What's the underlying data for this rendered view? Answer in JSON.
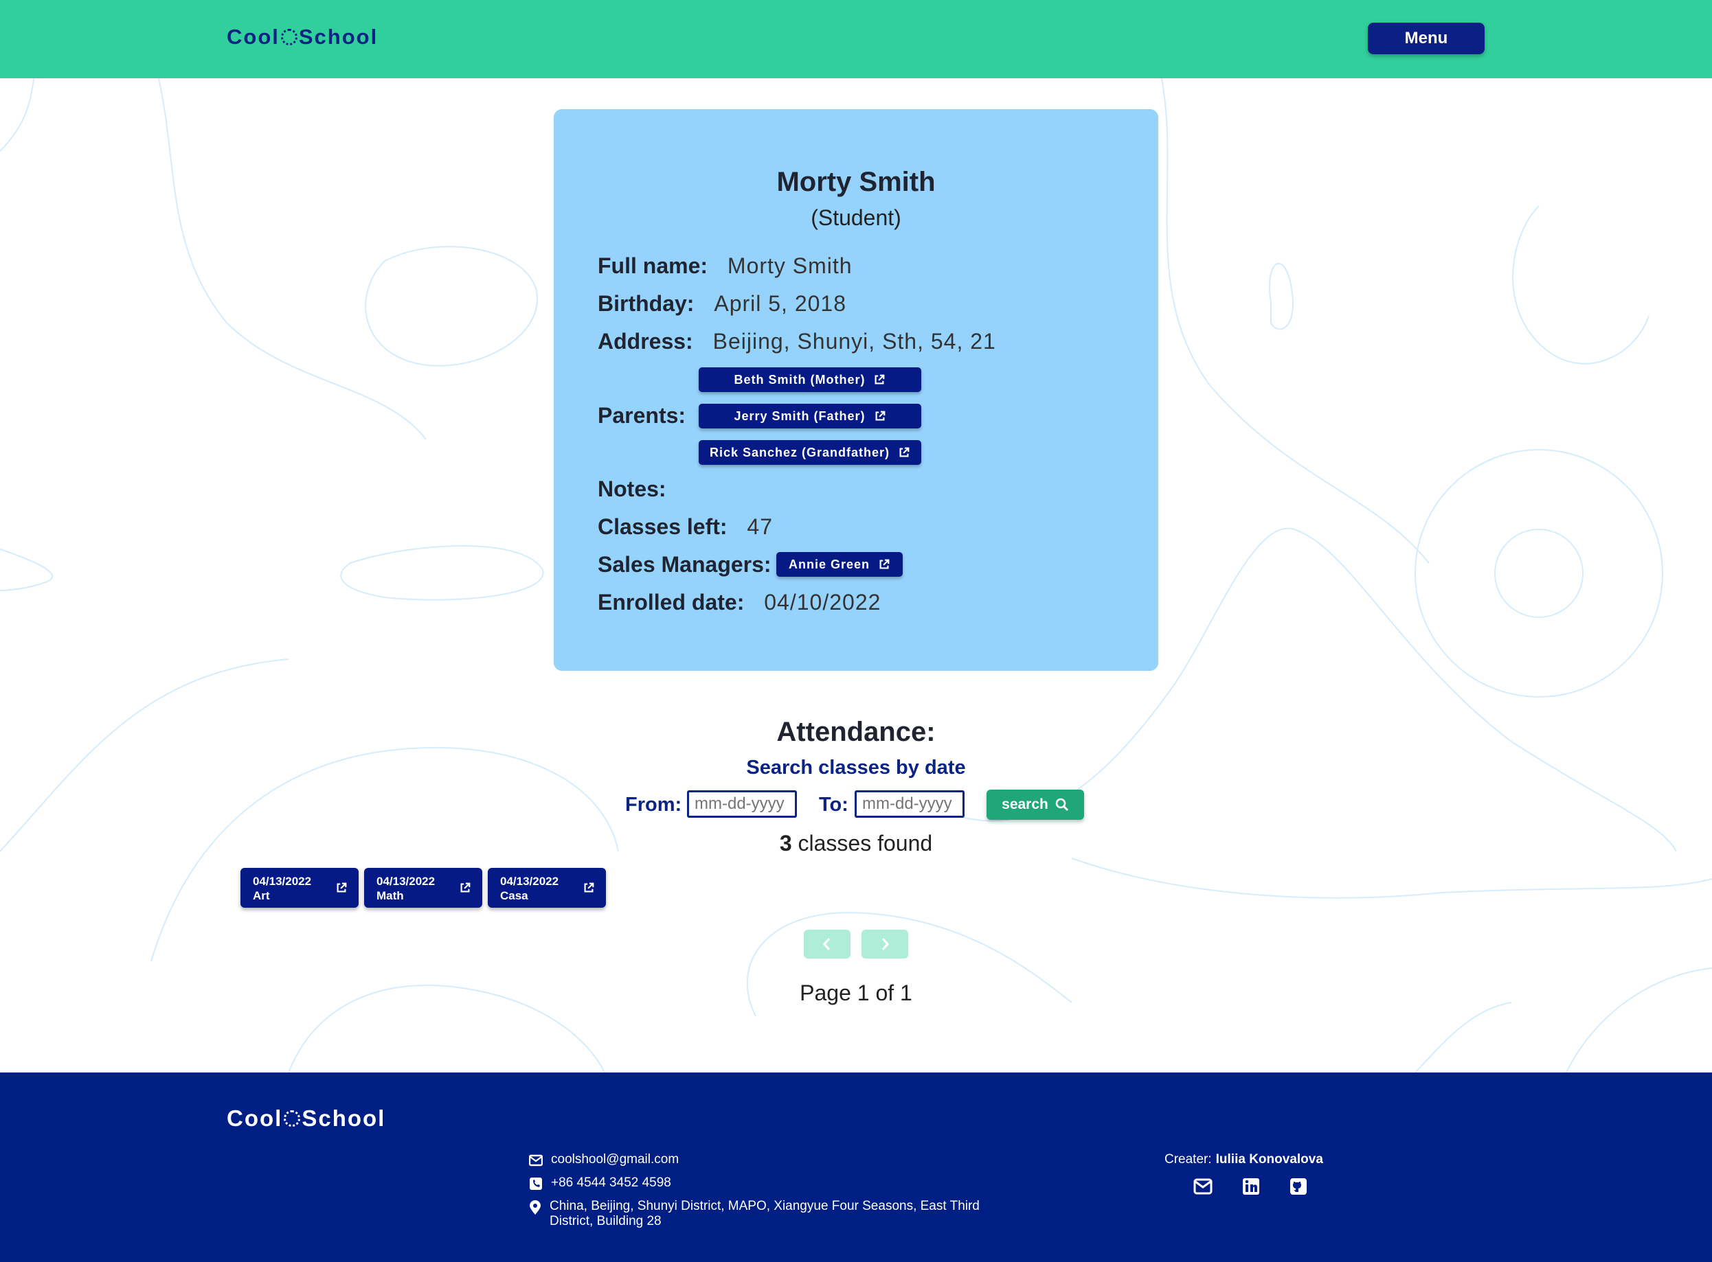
{
  "brand": {
    "logo_left": "Cool",
    "logo_right": "School"
  },
  "header": {
    "menu_label": "Menu"
  },
  "profile": {
    "name": "Morty Smith",
    "role": "(Student)",
    "full_name_label": "Full name:",
    "full_name": "Morty Smith",
    "birthday_label": "Birthday:",
    "birthday": "April 5, 2018",
    "address_label": "Address:",
    "address": "Beijing, Shunyi, Sth, 54, 21",
    "parents_label": "Parents:",
    "parents": [
      "Beth Smith (Mother)",
      "Jerry Smith (Father)",
      "Rick Sanchez (Grandfather)"
    ],
    "notes_label": "Notes:",
    "classes_left_label": "Classes left:",
    "classes_left": "47",
    "sales_managers_label": "Sales Managers:",
    "sales_managers": [
      "Annie Green"
    ],
    "enrolled_label": "Enrolled date:",
    "enrolled": "04/10/2022"
  },
  "attendance": {
    "title": "Attendance:",
    "subtitle": "Search classes by date",
    "from_label": "From:",
    "to_label": "To:",
    "from_placeholder": "mm-dd-yyyy",
    "to_placeholder": "mm-dd-yyyy",
    "search_label": "search",
    "found_count": "3",
    "found_text": " classes found",
    "classes": [
      {
        "date": "04/13/2022",
        "subject": "Art"
      },
      {
        "date": "04/13/2022",
        "subject": "Math"
      },
      {
        "date": "04/13/2022",
        "subject": "Casa"
      }
    ],
    "page_info": "Page 1 of 1"
  },
  "footer": {
    "email": "coolshool@gmail.com",
    "phone": "+86 4544 3452 4598",
    "address_line1": "China, Beijing, Shunyi District, MAPO, Xiangyue Four Seasons, East Third",
    "address_line2": "District, Building 28",
    "creator_label": "Creater:",
    "creator_name": "Iuliia Konovalova"
  },
  "icons": {
    "external": "external-link-icon",
    "search": "magnifier-icon",
    "prev": "chevron-left-icon",
    "next": "chevron-right-icon",
    "email": "envelope-icon",
    "phone": "phone-icon",
    "location": "map-pin-icon",
    "linkedin": "linkedin-icon",
    "github": "github-icon"
  },
  "colors": {
    "header_bg": "#30cf9b",
    "navy": "#061a86",
    "card_bg": "#96d3fc",
    "search_btn": "#1fa679",
    "footer_bg": "#001f85",
    "pager_btn": "#aeeed9"
  }
}
